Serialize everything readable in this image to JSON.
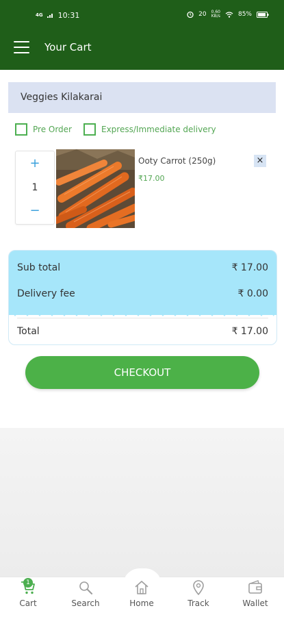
{
  "status_bar": {
    "network": "4G",
    "time": "10:31",
    "alarm_time": "20",
    "speed": "0.60",
    "speed_unit": "KB/s",
    "battery": "85%"
  },
  "header": {
    "title": "Your Cart",
    "menu_icon": "hamburger-menu-icon"
  },
  "store": {
    "name": "Veggies Kilakarai"
  },
  "options": [
    {
      "label": "Pre Order",
      "checked": false
    },
    {
      "label": "Express/Immediate delivery",
      "checked": false
    }
  ],
  "item": {
    "name": "Ooty Carrot (250g)",
    "price": "₹17.00",
    "quantity": "1",
    "plus": "+",
    "minus": "−",
    "remove": "×"
  },
  "summary": {
    "subtotal_label": "Sub total",
    "subtotal_value": "₹ 17.00",
    "delivery_label": "Delivery fee",
    "delivery_value": "₹ 0.00",
    "total_label": "Total",
    "total_value": "₹ 17.00"
  },
  "checkout_label": "CHECKOUT",
  "nav": {
    "cart": "Cart",
    "cart_badge": "1",
    "search": "Search",
    "home": "Home",
    "track": "Track",
    "wallet": "Wallet"
  },
  "colors": {
    "header": "#1f5e19",
    "accent_green": "#4cb148",
    "summary_bg": "#a6e6fa",
    "store_bar": "#dbe2f2"
  }
}
